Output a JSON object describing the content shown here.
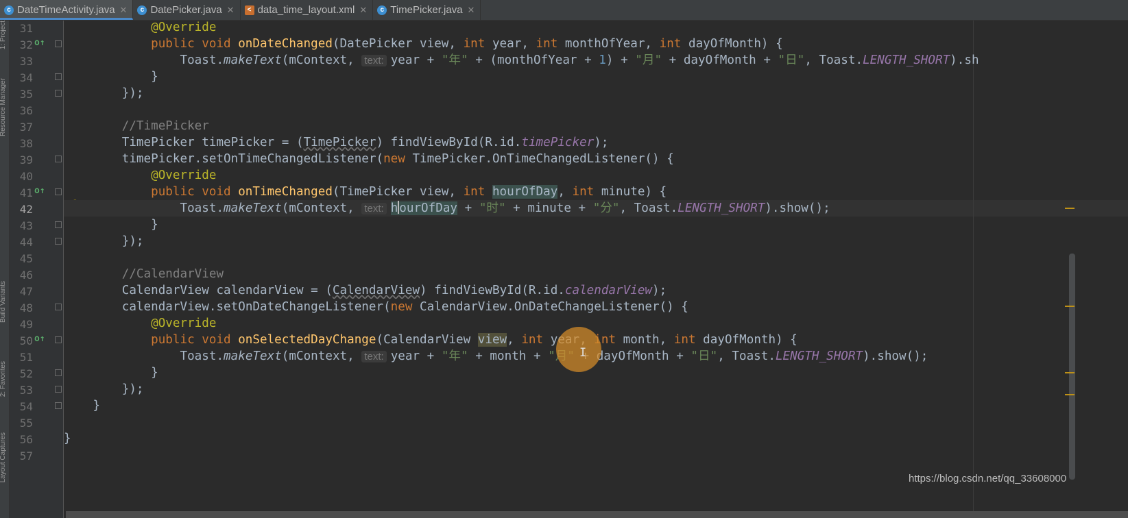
{
  "tabs": [
    {
      "label": "DateTimeActivity.java",
      "type": "java",
      "active": true
    },
    {
      "label": "DatePicker.java",
      "type": "java",
      "active": false
    },
    {
      "label": "data_time_layout.xml",
      "type": "xml",
      "active": false
    },
    {
      "label": "TimePicker.java",
      "type": "java",
      "active": false
    }
  ],
  "left_tools": [
    "1: Project",
    "Resource Manager",
    "Build Variants",
    "2: Favorites",
    "Layout Captures"
  ],
  "current_line": "42",
  "lines": [
    {
      "n": "31"
    },
    {
      "n": "32"
    },
    {
      "n": "33"
    },
    {
      "n": "34"
    },
    {
      "n": "35"
    },
    {
      "n": "36"
    },
    {
      "n": "37"
    },
    {
      "n": "38"
    },
    {
      "n": "39"
    },
    {
      "n": "40"
    },
    {
      "n": "41"
    },
    {
      "n": "42"
    },
    {
      "n": "43"
    },
    {
      "n": "44"
    },
    {
      "n": "45"
    },
    {
      "n": "46"
    },
    {
      "n": "47"
    },
    {
      "n": "48"
    },
    {
      "n": "49"
    },
    {
      "n": "50"
    },
    {
      "n": "51"
    },
    {
      "n": "52"
    },
    {
      "n": "53"
    },
    {
      "n": "54"
    },
    {
      "n": "55"
    },
    {
      "n": "56"
    },
    {
      "n": "57"
    }
  ],
  "code": {
    "l31": {
      "ann": "@Override"
    },
    "l32": {
      "kw1": "public void ",
      "fn": "onDateChanged",
      "rest": "(DatePicker view, ",
      "kw2": "int",
      "p1": " year, ",
      "kw3": "int",
      "p2": " monthOfYear, ",
      "kw4": "int",
      "p3": " dayOfMonth) {"
    },
    "l33": {
      "a": "Toast.",
      "m": "makeText",
      "b": "(mContext, ",
      "hint": "text:",
      "c": "year + ",
      "s1": "\"年\"",
      "d": " + (monthOfYear + ",
      "n": "1",
      "e": ") + ",
      "s2": "\"月\"",
      "f": " + dayOfMonth + ",
      "s3": "\"日\"",
      "g": ", Toast.",
      "st": "LENGTH_SHORT",
      "h": ").sh"
    },
    "l34": {
      "t": "}"
    },
    "l35": {
      "t": "});"
    },
    "l37": {
      "cmt": "//TimePicker"
    },
    "l38": {
      "a": "TimePicker timePicker = (",
      "w": "TimePicker",
      "b": ") findViewById(R.id.",
      "st": "timePicker",
      "c": ");"
    },
    "l39": {
      "a": "timePicker.setOnTimeChangedListener(",
      "kw": "new",
      "b": " TimePicker.OnTimeChangedListener() {"
    },
    "l40": {
      "ann": "@Override"
    },
    "l41": {
      "kw1": "public void ",
      "fn": "onTimeChanged",
      "a": "(TimePicker view, ",
      "kw2": "int",
      "hl": "hourOfDay",
      "b": ", ",
      "kw3": "int",
      "c": " minute) {"
    },
    "l42": {
      "a": "Toast.",
      "m": "makeText",
      "b": "(mContext, ",
      "hint": "text:",
      "h1": "h",
      "h2": "ourOfDay",
      "c": " + ",
      "s1": "\"时\"",
      "d": " + minute + ",
      "s2": "\"分\"",
      "e": ", Toast.",
      "st": "LENGTH_SHORT",
      "f": ").show();"
    },
    "l43": {
      "t": "}"
    },
    "l44": {
      "t": "});"
    },
    "l46": {
      "cmt": "//CalendarView"
    },
    "l47": {
      "a": "CalendarView calendarView = (",
      "w": "CalendarView",
      "b": ") findViewById(R.id.",
      "st": "calendarView",
      "c": ");"
    },
    "l48": {
      "a": "calendarView.setOnDateChangeListener(",
      "kw": "new",
      "b": " CalendarView.OnDateChangeListener() {"
    },
    "l49": {
      "ann": "@Override"
    },
    "l50": {
      "kw1": "public void ",
      "fn": "onSelectedDayChange",
      "a": "(CalendarView ",
      "hv": "view",
      "b": ", ",
      "kw2": "int",
      "c": " year, ",
      "kw3": "int",
      "d": " month, ",
      "kw4": "int",
      "e": " dayOfMonth) {"
    },
    "l51": {
      "a": "Toast.",
      "m": "makeText",
      "b": "(mContext, ",
      "hint": "text:",
      "c": "year + ",
      "s1": "\"年\"",
      "d": " + month + ",
      "s2": "\"月\"",
      "e": " + dayOfMonth + ",
      "s3": "\"日\"",
      "f": ", Toast.",
      "st": "LENGTH_SHORT",
      "g": ").show();"
    },
    "l52": {
      "t": "}"
    },
    "l53": {
      "t": "});"
    },
    "l54": {
      "t": "}"
    },
    "l56": {
      "t": "}"
    }
  },
  "watermark": "https://blog.csdn.net/qq_33608000",
  "colors": {
    "keyword": "#cc7832",
    "annotation": "#bbb529",
    "method": "#ffc66d",
    "string": "#6a8759",
    "number": "#6897bb",
    "comment": "#808080",
    "static": "#9876aa"
  }
}
